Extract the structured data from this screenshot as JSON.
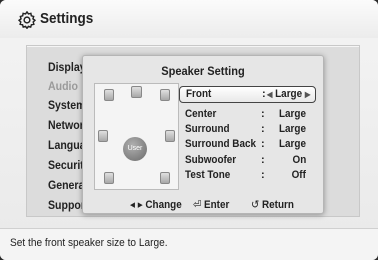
{
  "window": {
    "title": "Settings",
    "icon": "gear-icon"
  },
  "menu": {
    "items": [
      {
        "label": "Display",
        "dimmed": false
      },
      {
        "label": "Audio",
        "dimmed": true
      },
      {
        "label": "System",
        "dimmed": false
      },
      {
        "label": "Network",
        "dimmed": false
      },
      {
        "label": "Language",
        "dimmed": false
      },
      {
        "label": "Security",
        "dimmed": false
      },
      {
        "label": "General",
        "dimmed": false
      },
      {
        "label": "Support",
        "dimmed": false
      }
    ]
  },
  "dialog": {
    "title": "Speaker Setting",
    "user_label": "User",
    "rows": [
      {
        "label": "Front",
        "value": "Large",
        "selected": true
      },
      {
        "label": "Center",
        "value": "Large",
        "selected": false
      },
      {
        "label": "Surround",
        "value": "Large",
        "selected": false
      },
      {
        "label": "Surround Back",
        "value": "Large",
        "selected": false
      },
      {
        "label": "Subwoofer",
        "value": "On",
        "selected": false
      },
      {
        "label": "Test Tone",
        "value": "Off",
        "selected": false
      }
    ],
    "colon": ":",
    "hints": {
      "change_glyph": "◂ ▸",
      "change_label": "Change",
      "enter_glyph": "⏎",
      "enter_label": "Enter",
      "return_glyph": "↺",
      "return_label": "Return"
    }
  },
  "status": {
    "text": "Set the front speaker size to Large."
  }
}
